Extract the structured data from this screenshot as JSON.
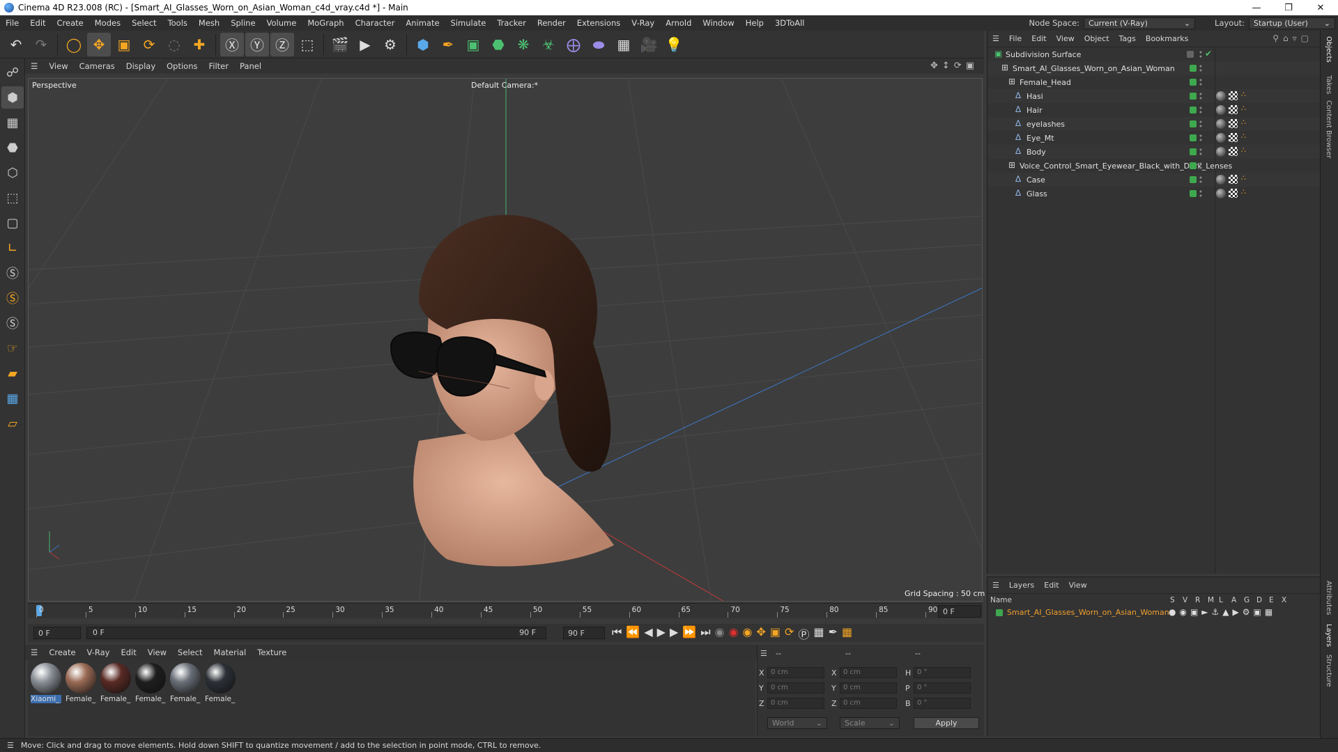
{
  "window": {
    "title": "Cinema 4D R23.008 (RC) - [Smart_AI_Glasses_Worn_on_Asian_Woman_c4d_vray.c4d *] - Main"
  },
  "menubar": {
    "items": [
      "File",
      "Edit",
      "Create",
      "Modes",
      "Select",
      "Tools",
      "Mesh",
      "Spline",
      "Volume",
      "MoGraph",
      "Character",
      "Animate",
      "Simulate",
      "Tracker",
      "Render",
      "Extensions",
      "V-Ray",
      "Arnold",
      "Window",
      "Help",
      "3DToAll"
    ],
    "node_space_label": "Node Space:",
    "node_space_value": "Current (V-Ray)",
    "layout_label": "Layout:",
    "layout_value": "Startup (User)"
  },
  "viewport": {
    "menu": [
      "View",
      "Cameras",
      "Display",
      "Options",
      "Filter",
      "Panel"
    ],
    "label": "Perspective",
    "camera": "Default Camera:*",
    "grid_spacing": "Grid Spacing : 50 cm"
  },
  "timeline": {
    "ticks": [
      "0",
      "5",
      "10",
      "15",
      "20",
      "25",
      "30",
      "35",
      "40",
      "45",
      "50",
      "55",
      "60",
      "65",
      "70",
      "75",
      "80",
      "85",
      "90"
    ],
    "current_frame_right": "0 F",
    "start": "0 F",
    "range_start": "0 F",
    "range_end": "90 F",
    "end": "90 F"
  },
  "material_manager": {
    "menu": [
      "Create",
      "V-Ray",
      "Edit",
      "View",
      "Select",
      "Material",
      "Texture"
    ],
    "materials": [
      {
        "label": "Xiaomi_",
        "color": "#8a8f96"
      },
      {
        "label": "Female_I",
        "color": "#9b6b55"
      },
      {
        "label": "Female_I",
        "color": "#5a2a24"
      },
      {
        "label": "Female_I",
        "color": "#1e1e1e"
      },
      {
        "label": "Female_I",
        "color": "#6a6f78"
      },
      {
        "label": "Female_I",
        "color": "#2c3036"
      }
    ]
  },
  "coordinates": {
    "headers": [
      "--",
      "--",
      "--"
    ],
    "rows": [
      {
        "a": "X",
        "av": "0 cm",
        "b": "X",
        "bv": "0 cm",
        "c": "H",
        "cv": "0 °"
      },
      {
        "a": "Y",
        "av": "0 cm",
        "b": "Y",
        "bv": "0 cm",
        "c": "P",
        "cv": "0 °"
      },
      {
        "a": "Z",
        "av": "0 cm",
        "b": "Z",
        "bv": "0 cm",
        "c": "B",
        "cv": "0 °"
      }
    ],
    "mode": "World",
    "type": "Scale",
    "apply": "Apply"
  },
  "object_manager": {
    "menu": [
      "File",
      "Edit",
      "View",
      "Object",
      "Tags",
      "Bookmarks"
    ],
    "objects": [
      {
        "name": "Subdivision Surface",
        "depth": 0
      },
      {
        "name": "Smart_AI_Glasses_Worn_on_Asian_Woman",
        "depth": 1
      },
      {
        "name": "Female_Head",
        "depth": 2
      },
      {
        "name": "Hasi",
        "depth": 3
      },
      {
        "name": "Hair",
        "depth": 3
      },
      {
        "name": "eyelashes",
        "depth": 3
      },
      {
        "name": "Eye_Mt",
        "depth": 3
      },
      {
        "name": "Body",
        "depth": 3
      },
      {
        "name": "Voice_Control_Smart_Eyewear_Black_with_Dark_Lenses",
        "depth": 2
      },
      {
        "name": "Case",
        "depth": 3
      },
      {
        "name": "Glass",
        "depth": 3
      }
    ]
  },
  "layers": {
    "menu": [
      "Layers",
      "Edit",
      "View"
    ],
    "columns": [
      "Name",
      "S",
      "V",
      "R",
      "M",
      "L",
      "A",
      "G",
      "D",
      "E",
      "X"
    ],
    "rows": [
      {
        "name": "Smart_AI_Glasses_Worn_on_Asian_Woman",
        "color": "#3ea84e"
      }
    ]
  },
  "side_tabs": [
    "Objects",
    "Takes",
    "Content Browser",
    "Attributes",
    "Layers",
    "Structure"
  ],
  "status": {
    "text": "Move: Click and drag to move elements. Hold down SHIFT to quantize movement / add to the selection in point mode, CTRL to remove."
  },
  "colors": {
    "accent": "#f5a623",
    "selection_text": "#f0a030",
    "axis_x": "#d04040",
    "axis_y": "#40c070",
    "axis_z": "#4080e0"
  }
}
